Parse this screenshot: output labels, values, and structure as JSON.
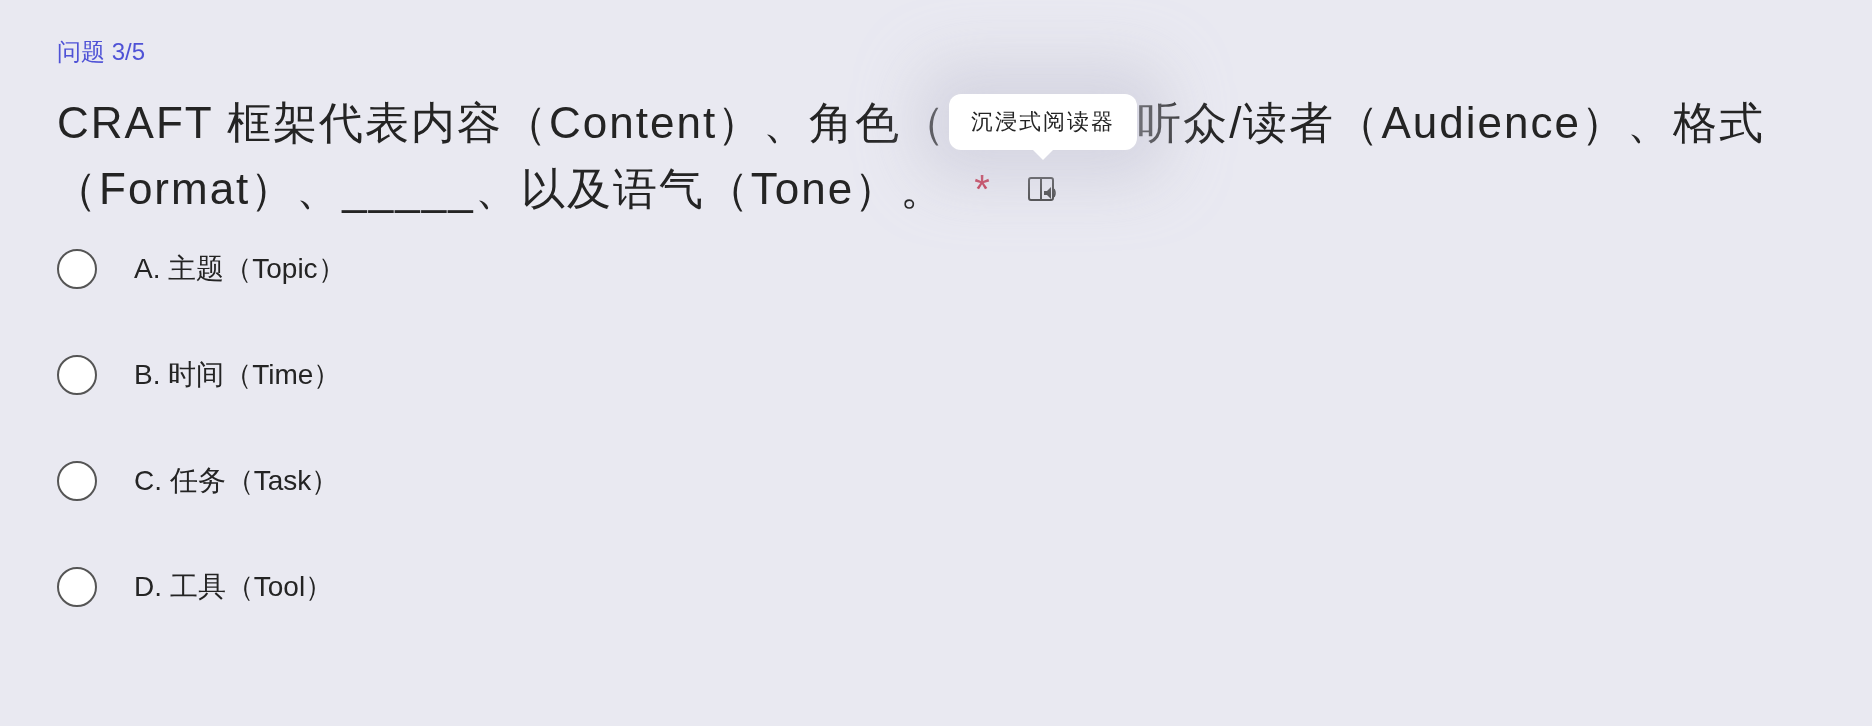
{
  "progress": "问题 3/5",
  "question": {
    "lines": [
      [
        "CRAFT 框架代表内容（Content）、角色（",
        "听众/读者（Audience）、格式"
      ],
      [
        "（Format）、_____、以及语气（Tone）。"
      ]
    ],
    "required_mark": "*"
  },
  "tooltip": "沉浸式阅读器",
  "options": [
    {
      "label": "A. 主题（Topic）",
      "selected": false
    },
    {
      "label": "B. 时间（Time）",
      "selected": false
    },
    {
      "label": "C. 任务（Task）",
      "selected": false
    },
    {
      "label": "D. 工具（Tool）",
      "selected": false
    }
  ]
}
